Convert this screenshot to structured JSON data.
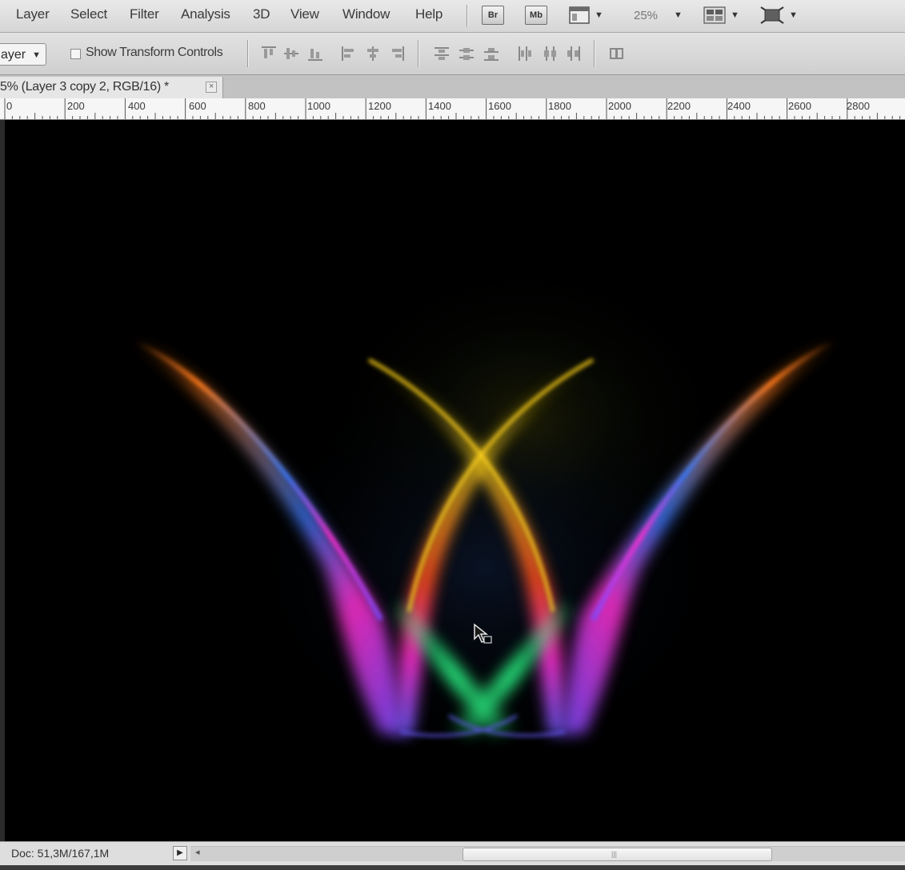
{
  "menu": {
    "items": [
      "Layer",
      "Select",
      "Filter",
      "Analysis",
      "3D",
      "View",
      "Window",
      "Help"
    ]
  },
  "app_bar": {
    "bridge_icon": "Br",
    "minibridge_icon": "Mb",
    "zoom": "25%"
  },
  "options": {
    "auto_select_value": "ayer",
    "show_transform_controls": "Show Transform Controls",
    "show_transform_checked": false
  },
  "document": {
    "tab_title": "5% (Layer 3 copy 2, RGB/16) *",
    "close_glyph": "×"
  },
  "ruler": {
    "labels": [
      "0",
      "200",
      "400",
      "600",
      "800",
      "1000",
      "1200",
      "1400",
      "1600",
      "1800",
      "2000",
      "2200",
      "2400",
      "2600",
      "2800"
    ]
  },
  "status": {
    "doc_size": "Doc: 51,3M/167,1M"
  },
  "colors": {
    "canvas_background": "#000000",
    "ribbon_orange": "#ff7a1a",
    "ribbon_magenta": "#ff2fd0",
    "ribbon_yellow": "#ffd21a",
    "ribbon_green": "#2cff8a",
    "ribbon_blue": "#3a7bff"
  }
}
